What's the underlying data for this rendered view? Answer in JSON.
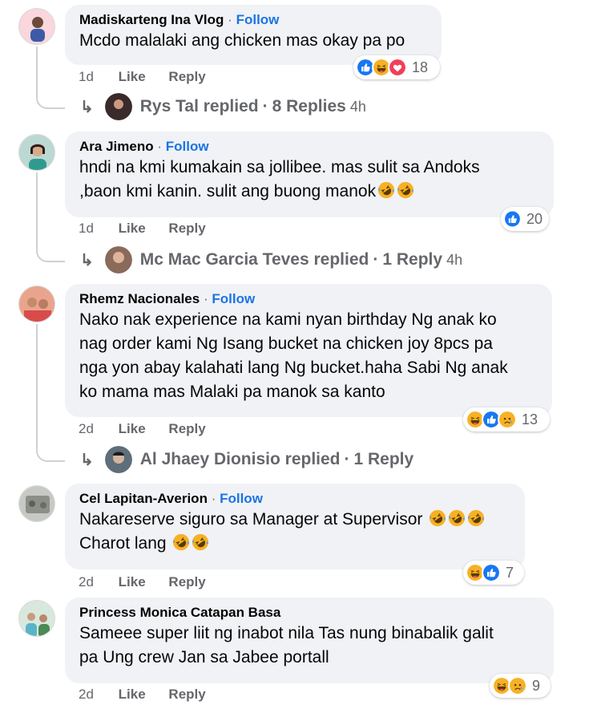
{
  "comments": [
    {
      "author": "Madiskarteng Ina Vlog",
      "follow": "Follow",
      "lines": [
        "Mcdo malalaki ang chicken mas okay pa po"
      ],
      "time": "1d",
      "like": "Like",
      "reply": "Reply",
      "reactions": [
        "like-icon",
        "haha-icon",
        "love-icon"
      ],
      "reaction_count": "18",
      "replies": {
        "name": "Rys Tal replied",
        "count": "8 Replies",
        "time": "4h"
      }
    },
    {
      "author": "Ara Jimeno",
      "follow": "Follow",
      "lines": [
        "hndi na kmi kumakain sa jollibee. mas sulit sa Andoks",
        ",baon kmi kanin. sulit ang buong manok"
      ],
      "time": "1d",
      "like": "Like",
      "reply": "Reply",
      "reactions": [
        "like-icon"
      ],
      "reaction_count": "20",
      "replies": {
        "name": "Mc Mac Garcia Teves replied",
        "count": "1 Reply",
        "time": "4h"
      }
    },
    {
      "author": "Rhemz Nacionales",
      "follow": "Follow",
      "lines": [
        "Nako nak experience na kami nyan birthday Ng anak ko",
        "nag order kami Ng Isang bucket na chicken joy 8pcs pa",
        "nga yon abay kalahati lang Ng bucket.haha Sabi Ng anak",
        "ko mama mas Malaki pa manok sa kanto"
      ],
      "time": "2d",
      "like": "Like",
      "reply": "Reply",
      "reactions": [
        "haha-icon",
        "like-icon",
        "sad-icon"
      ],
      "reaction_count": "13",
      "replies": {
        "name": "Al Jhaey Dionisio replied",
        "count": "1 Reply",
        "time": ""
      }
    },
    {
      "author": "Cel Lapitan-Averion",
      "follow": "Follow",
      "lines": [
        "Nakareserve siguro sa Manager at Supervisor",
        "Charot lang"
      ],
      "time": "2d",
      "like": "Like",
      "reply": "Reply",
      "reactions": [
        "haha-icon",
        "like-icon"
      ],
      "reaction_count": "7"
    },
    {
      "author": "Princess Monica Catapan Basa",
      "follow": "",
      "lines": [
        "Sameee super liit ng inabot nila Tas nung binabalik galit",
        "pa Ung crew Jan sa Jabee portall"
      ],
      "time": "2d",
      "like": "Like",
      "reply": "Reply",
      "reactions": [
        "haha-icon",
        "sad-icon"
      ],
      "reaction_count": "9"
    }
  ],
  "sep": "·",
  "colors": {
    "bubble": "#f0f2f5",
    "follow": "#1b74e4",
    "meta": "#65676b",
    "like": "#1877f2",
    "love": "#f33e58",
    "haha": "#f7b125"
  }
}
